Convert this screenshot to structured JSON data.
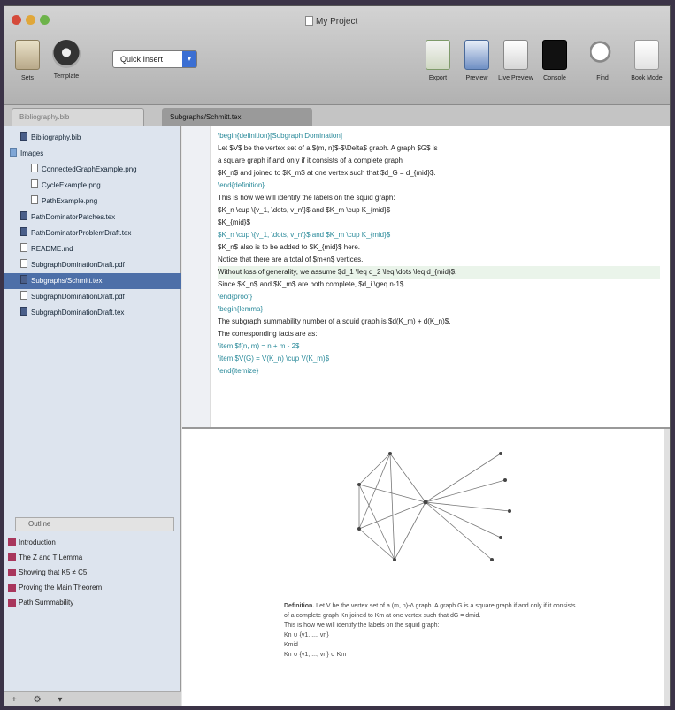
{
  "window": {
    "title": "My Project"
  },
  "toolbar": {
    "left_tools": [
      {
        "label": "Sets",
        "icon": "sets-icon"
      },
      {
        "label": "Template",
        "icon": "template-icon"
      }
    ],
    "quick_insert": {
      "label": "Quick Insert",
      "arrow": "▾"
    },
    "right_tools": [
      {
        "label": "Export",
        "icon": "export-icon"
      },
      {
        "label": "Preview",
        "icon": "preview-icon"
      },
      {
        "label": "Live Preview",
        "icon": "live-preview-icon"
      },
      {
        "label": "Console",
        "icon": "console-icon"
      },
      {
        "label": "Find",
        "icon": "find-icon"
      },
      {
        "label": "Book Mode",
        "icon": "book-mode-icon"
      }
    ],
    "colors": {
      "accent": "#3b6fd3"
    }
  },
  "tabs": [
    {
      "label": "Bibliography.bib"
    },
    {
      "label": "Subgraphs/Schmitt.tex"
    }
  ],
  "file_tree": [
    {
      "label": "Bibliography.bib",
      "kind": "tex",
      "indent": 1
    },
    {
      "label": "Images",
      "kind": "folder",
      "indent": 0
    },
    {
      "label": "ConnectedGraphExample.png",
      "kind": "file",
      "indent": 2
    },
    {
      "label": "CycleExample.png",
      "kind": "file",
      "indent": 2
    },
    {
      "label": "PathExample.png",
      "kind": "file",
      "indent": 2
    },
    {
      "label": "PathDominatorPatches.tex",
      "kind": "tex",
      "indent": 1
    },
    {
      "label": "PathDominatorProblemDraft.tex",
      "kind": "tex",
      "indent": 1
    },
    {
      "label": "README.md",
      "kind": "file",
      "indent": 1
    },
    {
      "label": "SubgraphDominationDraft.pdf",
      "kind": "file",
      "indent": 1
    },
    {
      "label": "Subgraphs/Schmitt.tex",
      "kind": "tex",
      "indent": 1,
      "selected": true
    },
    {
      "label": "SubgraphDominationDraft.pdf",
      "kind": "file",
      "indent": 1
    },
    {
      "label": "SubgraphDominationDraft.tex",
      "kind": "tex",
      "indent": 1
    }
  ],
  "outline": {
    "header": "Outline",
    "items": [
      "Introduction",
      "The Z and T Lemma",
      "Showing that K5 ≠ C5",
      "Proving the Main Theorem",
      "Path Summability"
    ]
  },
  "sidebar_bottom": "+ ⚙ ▾",
  "code_lines": [
    {
      "text": "\\begin{definition}[Subgraph Domination]",
      "cmd": true
    },
    {
      "text": "Let $V$ be the vertex set of a $(m, n)$-$\\Delta$ graph. A graph $G$ is",
      "cmd": false
    },
    {
      "text": "a square graph if and only if it consists of a complete graph",
      "cmd": false
    },
    {
      "text": "$K_n$ and joined to $K_m$ at one vertex such that $d_G = d_{mid}$.",
      "cmd": false
    },
    {
      "text": "\\end{definition}",
      "cmd": true
    },
    {
      "text": "This is how we will identify the labels on the squid graph:",
      "cmd": false
    },
    {
      "text": "$K_n \\cup \\{v_1, \\dots, v_n\\}$ and $K_m \\cup K_{mid}$",
      "cmd": false
    },
    {
      "text": "$K_{mid}$",
      "cmd": false
    },
    {
      "text": "$K_n \\cup \\{v_1, \\dots, v_n\\}$ and $K_m \\cup K_{mid}$",
      "cmd": true
    },
    {
      "text": "$K_n$ also is to be added to $K_{mid}$ here.",
      "cmd": false
    },
    {
      "text": "Notice that there are a total of $m+n$ vertices.",
      "cmd": false
    },
    {
      "text": "Without loss of generality, we assume $d_1 \\leq d_2 \\leq \\dots \\leq d_{mid}$.",
      "cmd": false,
      "highlight": true
    },
    {
      "text": "Since $K_n$ and $K_m$ are both complete, $d_i \\geq n-1$.",
      "cmd": false
    },
    {
      "text": "\\end{proof}",
      "cmd": true
    },
    {
      "text": "\\begin{lemma}",
      "cmd": true
    },
    {
      "text": "The subgraph summability number of a squid graph is $d(K_m) + d(K_n)$.",
      "cmd": false
    },
    {
      "text": "The corresponding facts are as:",
      "cmd": false
    },
    {
      "text": "\\item $f(n, m) = n + m - 2$",
      "cmd": true
    },
    {
      "text": "\\item $V(G) = V(K_n) \\cup V(K_m)$",
      "cmd": true
    },
    {
      "text": "\\end{itemize}",
      "cmd": true
    }
  ],
  "pdf": {
    "definition_label": "Definition.",
    "definition_text": "Let V be the vertex set of a (m, n)-Δ graph. A graph G is a square graph if and only if it consists of a complete graph Kn joined to Km at one vertex such that dG = dmid.",
    "lines": [
      "This is how we will identify the labels on the squid graph:",
      "Kn ∪ {v1, ..., vn}",
      "Kmid",
      "Kn ∪ {v1, ..., vn} ∪ Km"
    ]
  }
}
